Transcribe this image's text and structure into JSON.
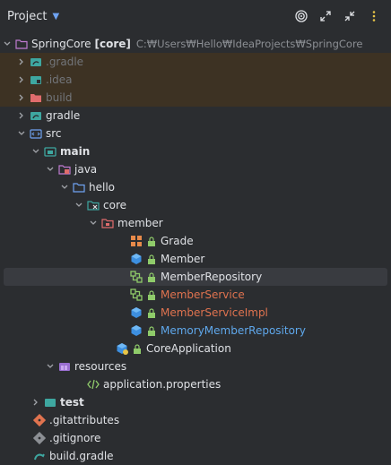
{
  "header": {
    "title": "Project"
  },
  "tree": {
    "root": {
      "name": "SpringCore",
      "module": "[core]",
      "path": "C:₩Users₩Hello₩IdeaProjects₩SpringCore"
    },
    "gradle_hidden": ".gradle",
    "idea": ".idea",
    "build": "build",
    "gradle": "gradle",
    "src": "src",
    "main": "main",
    "java": "java",
    "hello": "hello",
    "core": "core",
    "member": "member",
    "classes": [
      {
        "name": "Grade"
      },
      {
        "name": "Member"
      },
      {
        "name": "MemberRepository"
      },
      {
        "name": "MemberService"
      },
      {
        "name": "MemberServiceImpl"
      },
      {
        "name": "MemoryMemberRepository"
      }
    ],
    "core_app": "CoreApplication",
    "resources": "resources",
    "app_props": "application.properties",
    "test": "test",
    "gitattributes": ".gitattributes",
    "gitignore": ".gitignore",
    "build_gradle": "build.gradle"
  },
  "colors": {
    "background": "#2b2d30",
    "excluded_row": "#3d3223",
    "selected_row": "#393b40",
    "modified_orange": "#e0734f",
    "added_blue": "#5fa8ec"
  }
}
